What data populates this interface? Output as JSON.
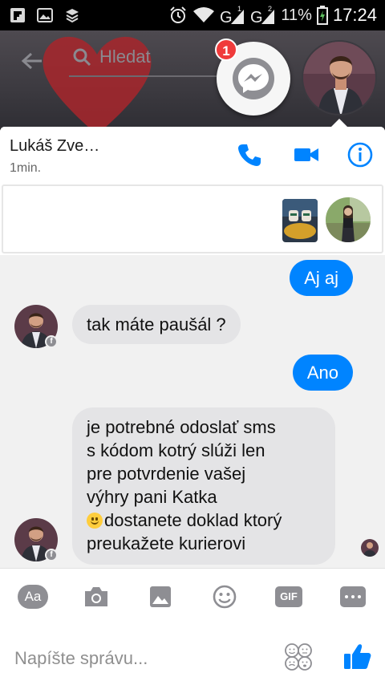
{
  "status_bar": {
    "battery": "11%",
    "time": "17:24",
    "signal_1_label": "1",
    "signal_2_label": "2"
  },
  "background": {
    "search_placeholder": "Hledat"
  },
  "chat_heads": {
    "unread_count": "1"
  },
  "chat": {
    "contact_name": "Lukáš Zve…",
    "last_active": "1min."
  },
  "messages": [
    {
      "direction": "outgoing",
      "text": "Aj aj"
    },
    {
      "direction": "incoming",
      "text": "tak máte paušál ?"
    },
    {
      "direction": "outgoing",
      "text": "Ano"
    },
    {
      "direction": "incoming",
      "lines": [
        "je potrebné odoslať sms",
        "s kódom kotrý slúži len",
        "pre potvrdenie vašej",
        "výhry pani Katka",
        "dostanete doklad ktorý",
        "preukažete kurierovi"
      ]
    }
  ],
  "composer": {
    "aa_label": "Aa",
    "gif_label": "GIF",
    "placeholder": "Napíšte správu..."
  },
  "colors": {
    "accent": "#0084ff",
    "bubble_incoming": "#e4e4e6",
    "badge": "#f03b3b"
  },
  "icons": [
    "flipboard-icon",
    "gallery-icon",
    "layers-icon",
    "alarm-icon",
    "wifi-icon",
    "signal-icon",
    "battery-icon",
    "back-arrow-icon",
    "search-icon",
    "messenger-icon",
    "phone-icon",
    "video-camera-icon",
    "info-icon",
    "camera-icon",
    "image-icon",
    "emoji-icon",
    "more-icon",
    "sticker-icon",
    "thumbs-up-icon"
  ]
}
